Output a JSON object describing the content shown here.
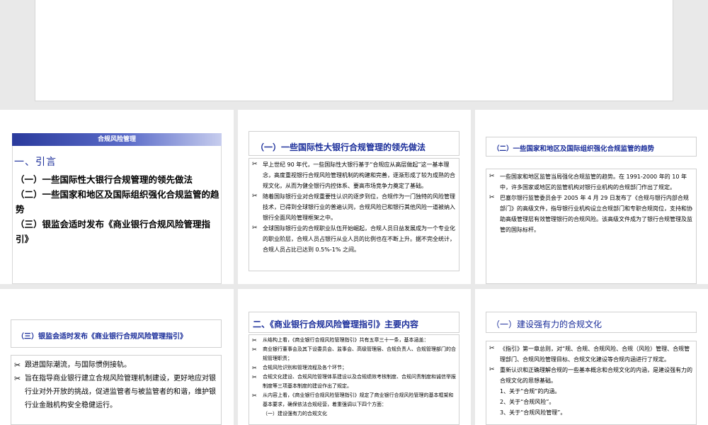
{
  "slide1": {
    "header_bar": "合规风险管理",
    "intro_title": "一、引言",
    "items": [
      "（一）一些国际性大银行合规管理的领先做法",
      "（二）一些国家和地区及国际组织强化合规监管的趋势",
      "（三）银监会适时发布《商业银行合规风险管理指引》"
    ]
  },
  "slide2": {
    "title": "（一）一些国际性大银行合规管理的领先做法",
    "paragraphs": [
      "早上世纪 90 年代，一些国际性大银行基于“合规应从高层做起”这一基本理念，高度重视银行合规风险管理机制的构建和完善，逐渐形成了较为成熟的合规文化，从而为健全银行内控体系、要高市场竞争力奠定了基础。",
      "随着国际银行业对合规重要性认识的逐步到位，合规作为一门独特的风险管理技术，已得到全球银行业的普遍认同，合规风险已和银行其他风险一道被纳入银行全面风险管理框架之中。",
      "全球国际银行业的合规职业队伍开始崛起，合规人员日益发展成为一个专业化的职业阶层，合规人员占银行从业人员的比例也在不断上升。据不完全统计，合规人员占比已达到 0.5%-1% 之间。"
    ]
  },
  "slide3": {
    "title": "（二）一些国家和地区及国际组织强化合规监管的趋势",
    "paragraphs": [
      "一些国家和地区监管当局强化合规监管的趋势。在 1991-2000 年的 10 年中，许多国家或地区的监管机构对银行业机构的合规部门作出了规定。",
      "巴塞尔银行监管委员会于 2005 年 4 月 29 日发布了《合规与银行内部合规部门》的高级文件，指导银行业机构设立合规部门和专职合规岗位，支持和协助高级管理层有效管理银行的合规风险。该高级文件成为了银行合规管理及监管的国际标杆。"
    ]
  },
  "slide4": {
    "title": "（三）银监会适时发布《商业银行合规风险管理指引》",
    "paragraphs": [
      "跟进国际潮流，与国际惯例接轨。",
      "旨在指导商业银行建立合规风险管理机制建设，更好地应对银行业对外开放的挑战，促进监管者与被监管者的和谐，维护银行业金融机构安全稳健运行。"
    ]
  },
  "slide5": {
    "title": "二、《商业银行合规风险管理指引》主要内容",
    "paragraphs": [
      "从结构上看，《商业银行合规风险管理指引》共有五章三十一条，基本涵盖：",
      "商业银行董事会及其下设委员会、监事会、高级管理层、合规负责人、合规管理部门的合规管理职责；",
      "合规风险识别和管理流程及各个环节；",
      "合规文化建设、合规风险管理体系建设以及合规绩效考核制度、合规问责制度和诚信举报制度等三项基本制度的建设作出了规定。",
      "从内容上看，《商业银行合规风险管理指引》规定了商业银行合规风险管理的基本框架和基本要求，确保依法合规经营，着重强调以下四个方面："
    ],
    "sub_item": "（一）建设强有力的合规文化"
  },
  "slide6": {
    "title": "（一）建设强有力的合规文化",
    "paragraphs": [
      "《指引》第一章总则，对“规、合规、合规风险、合规（风险）管理、合规管理部门、合规风险管理目标、合规文化建设等合规内涵进行了规定。",
      "重新认识和正确理解合规的一些基本概念和合规文化的内涵，是建设强有力的合规文化的思想基础。"
    ],
    "numbered": [
      "1、关于“合规”的内涵。",
      "2、关于“合规风险”。",
      "3、关于“合规风险管理”。"
    ]
  },
  "bullet_icon": "scissors-icon"
}
